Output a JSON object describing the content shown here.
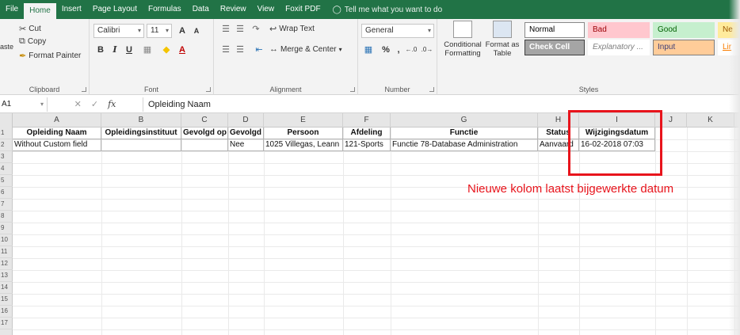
{
  "ribbon_tabs": [
    "File",
    "Home",
    "Insert",
    "Page Layout",
    "Formulas",
    "Data",
    "Review",
    "View",
    "Foxit PDF"
  ],
  "tell_me": "Tell me what you want to do",
  "clipboard": {
    "cut": "Cut",
    "copy": "Copy",
    "format_painter": "Format Painter",
    "paste_fragment": "aste",
    "label": "Clipboard"
  },
  "font": {
    "name": "Calibri",
    "size": "11",
    "label": "Font"
  },
  "alignment": {
    "wrap_text": "Wrap Text",
    "merge_center": "Merge & Center",
    "label": "Alignment"
  },
  "number": {
    "format": "General",
    "label": "Number",
    "percent": "%",
    "comma": ","
  },
  "styles": {
    "conditional": "Conditional Formatting",
    "format_as_table": "Format as Table",
    "label": "Styles",
    "boxes": [
      {
        "text": "Normal",
        "bg": "#ffffff",
        "fg": "#000000",
        "border": "#888888"
      },
      {
        "text": "Bad",
        "bg": "#ffc7ce",
        "fg": "#9c0006",
        "border": "#ffc7ce"
      },
      {
        "text": "Good",
        "bg": "#c6efce",
        "fg": "#006100",
        "border": "#c6efce"
      },
      {
        "text": "Ne",
        "bg": "#ffeb9c",
        "fg": "#9c5700",
        "border": "#ffeb9c"
      },
      {
        "text": "Check Cell",
        "bg": "#a5a5a5",
        "fg": "#ffffff",
        "border": "#3f3f3f"
      },
      {
        "text": "Explanatory ...",
        "bg": "#ffffff",
        "fg": "#7f7f7f",
        "border": "#ffffff"
      },
      {
        "text": "Input",
        "bg": "#ffcc99",
        "fg": "#3f3f76",
        "border": "#7f7f7f"
      },
      {
        "text": "Lir",
        "bg": "#ffffff",
        "fg": "#fa7d00",
        "border": "#ffffff"
      }
    ]
  },
  "formula_bar": {
    "name_box": "A1",
    "content": "Opleiding Naam"
  },
  "columns": [
    "A",
    "B",
    "C",
    "D",
    "E",
    "F",
    "G",
    "H",
    "I",
    "J",
    "K"
  ],
  "rows": [
    "1",
    "2",
    "3",
    "4",
    "5",
    "6",
    "7",
    "8",
    "9",
    "10",
    "11",
    "12",
    "13",
    "14",
    "15",
    "16",
    "17"
  ],
  "table": {
    "headers": [
      "Opleiding Naam",
      "Opleidingsinstituut",
      "Gevolgd op",
      "Gevolgd",
      "Persoon",
      "Afdeling",
      "Functie",
      "Status",
      "Wijzigingsdatum"
    ],
    "row": [
      "Without Custom field",
      "",
      "",
      "Nee",
      "1025 Villegas, Leann",
      "121-Sports",
      "Functie 78-Database Administration",
      "Aanvaard",
      "16-02-2018 07:03"
    ]
  },
  "annotation": {
    "text": "Nieuwe kolom laatst bijgewerkte datum",
    "color": "#e8141c"
  },
  "accent": "#217346"
}
